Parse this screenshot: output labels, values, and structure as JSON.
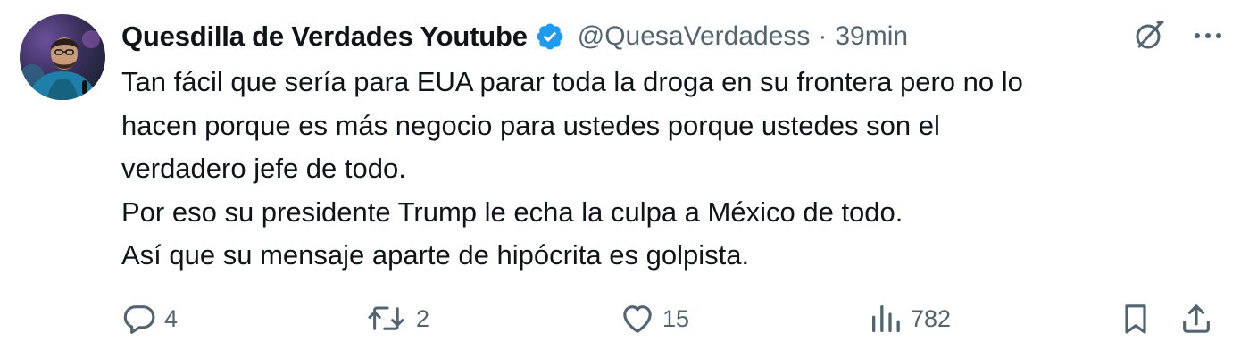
{
  "tweet": {
    "author": {
      "display_name": "Quesdilla de Verdades Youtube",
      "handle": "@QuesaVerdadess",
      "separator": "·",
      "time": "39min",
      "verified": true
    },
    "body_lines": [
      "Tan fácil que sería para EUA parar toda la droga en su frontera pero no lo",
      "hacen porque es más negocio para ustedes porque ustedes son el",
      "verdadero jefe de todo.",
      "Por eso su presidente Trump le echa la culpa a México de todo.",
      "Así que su mensaje aparte de hipócrita es golpista."
    ],
    "stats": {
      "replies": "4",
      "reposts": "2",
      "likes": "15",
      "views": "782"
    },
    "icons": {
      "header": [
        "grok-icon",
        "more-icon"
      ],
      "actions": [
        "reply-icon",
        "repost-icon",
        "like-icon",
        "views-icon",
        "bookmark-icon",
        "share-icon"
      ]
    },
    "colors": {
      "text": "#0f1419",
      "secondary": "#536471",
      "verified_badge": "#1d9bf0"
    }
  }
}
